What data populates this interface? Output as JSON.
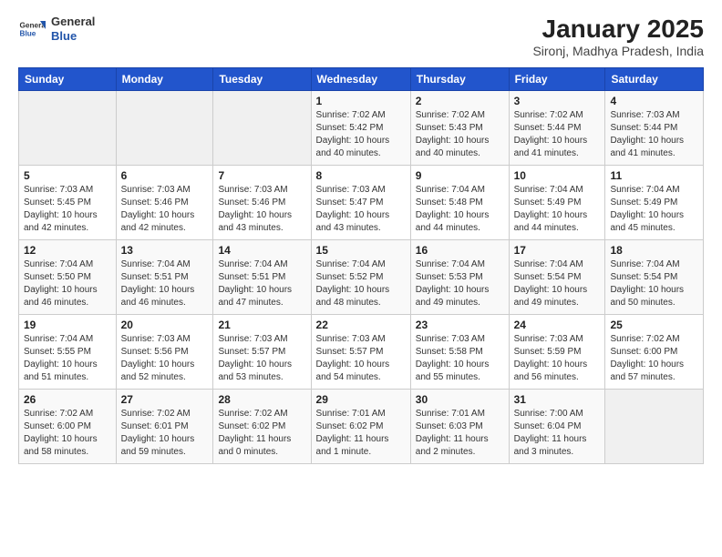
{
  "header": {
    "logo_general": "General",
    "logo_blue": "Blue",
    "month_title": "January 2025",
    "location": "Sironj, Madhya Pradesh, India"
  },
  "weekdays": [
    "Sunday",
    "Monday",
    "Tuesday",
    "Wednesday",
    "Thursday",
    "Friday",
    "Saturday"
  ],
  "weeks": [
    [
      {
        "day": "",
        "info": ""
      },
      {
        "day": "",
        "info": ""
      },
      {
        "day": "",
        "info": ""
      },
      {
        "day": "1",
        "info": "Sunrise: 7:02 AM\nSunset: 5:42 PM\nDaylight: 10 hours\nand 40 minutes."
      },
      {
        "day": "2",
        "info": "Sunrise: 7:02 AM\nSunset: 5:43 PM\nDaylight: 10 hours\nand 40 minutes."
      },
      {
        "day": "3",
        "info": "Sunrise: 7:02 AM\nSunset: 5:44 PM\nDaylight: 10 hours\nand 41 minutes."
      },
      {
        "day": "4",
        "info": "Sunrise: 7:03 AM\nSunset: 5:44 PM\nDaylight: 10 hours\nand 41 minutes."
      }
    ],
    [
      {
        "day": "5",
        "info": "Sunrise: 7:03 AM\nSunset: 5:45 PM\nDaylight: 10 hours\nand 42 minutes."
      },
      {
        "day": "6",
        "info": "Sunrise: 7:03 AM\nSunset: 5:46 PM\nDaylight: 10 hours\nand 42 minutes."
      },
      {
        "day": "7",
        "info": "Sunrise: 7:03 AM\nSunset: 5:46 PM\nDaylight: 10 hours\nand 43 minutes."
      },
      {
        "day": "8",
        "info": "Sunrise: 7:03 AM\nSunset: 5:47 PM\nDaylight: 10 hours\nand 43 minutes."
      },
      {
        "day": "9",
        "info": "Sunrise: 7:04 AM\nSunset: 5:48 PM\nDaylight: 10 hours\nand 44 minutes."
      },
      {
        "day": "10",
        "info": "Sunrise: 7:04 AM\nSunset: 5:49 PM\nDaylight: 10 hours\nand 44 minutes."
      },
      {
        "day": "11",
        "info": "Sunrise: 7:04 AM\nSunset: 5:49 PM\nDaylight: 10 hours\nand 45 minutes."
      }
    ],
    [
      {
        "day": "12",
        "info": "Sunrise: 7:04 AM\nSunset: 5:50 PM\nDaylight: 10 hours\nand 46 minutes."
      },
      {
        "day": "13",
        "info": "Sunrise: 7:04 AM\nSunset: 5:51 PM\nDaylight: 10 hours\nand 46 minutes."
      },
      {
        "day": "14",
        "info": "Sunrise: 7:04 AM\nSunset: 5:51 PM\nDaylight: 10 hours\nand 47 minutes."
      },
      {
        "day": "15",
        "info": "Sunrise: 7:04 AM\nSunset: 5:52 PM\nDaylight: 10 hours\nand 48 minutes."
      },
      {
        "day": "16",
        "info": "Sunrise: 7:04 AM\nSunset: 5:53 PM\nDaylight: 10 hours\nand 49 minutes."
      },
      {
        "day": "17",
        "info": "Sunrise: 7:04 AM\nSunset: 5:54 PM\nDaylight: 10 hours\nand 49 minutes."
      },
      {
        "day": "18",
        "info": "Sunrise: 7:04 AM\nSunset: 5:54 PM\nDaylight: 10 hours\nand 50 minutes."
      }
    ],
    [
      {
        "day": "19",
        "info": "Sunrise: 7:04 AM\nSunset: 5:55 PM\nDaylight: 10 hours\nand 51 minutes."
      },
      {
        "day": "20",
        "info": "Sunrise: 7:03 AM\nSunset: 5:56 PM\nDaylight: 10 hours\nand 52 minutes."
      },
      {
        "day": "21",
        "info": "Sunrise: 7:03 AM\nSunset: 5:57 PM\nDaylight: 10 hours\nand 53 minutes."
      },
      {
        "day": "22",
        "info": "Sunrise: 7:03 AM\nSunset: 5:57 PM\nDaylight: 10 hours\nand 54 minutes."
      },
      {
        "day": "23",
        "info": "Sunrise: 7:03 AM\nSunset: 5:58 PM\nDaylight: 10 hours\nand 55 minutes."
      },
      {
        "day": "24",
        "info": "Sunrise: 7:03 AM\nSunset: 5:59 PM\nDaylight: 10 hours\nand 56 minutes."
      },
      {
        "day": "25",
        "info": "Sunrise: 7:02 AM\nSunset: 6:00 PM\nDaylight: 10 hours\nand 57 minutes."
      }
    ],
    [
      {
        "day": "26",
        "info": "Sunrise: 7:02 AM\nSunset: 6:00 PM\nDaylight: 10 hours\nand 58 minutes."
      },
      {
        "day": "27",
        "info": "Sunrise: 7:02 AM\nSunset: 6:01 PM\nDaylight: 10 hours\nand 59 minutes."
      },
      {
        "day": "28",
        "info": "Sunrise: 7:02 AM\nSunset: 6:02 PM\nDaylight: 11 hours\nand 0 minutes."
      },
      {
        "day": "29",
        "info": "Sunrise: 7:01 AM\nSunset: 6:02 PM\nDaylight: 11 hours\nand 1 minute."
      },
      {
        "day": "30",
        "info": "Sunrise: 7:01 AM\nSunset: 6:03 PM\nDaylight: 11 hours\nand 2 minutes."
      },
      {
        "day": "31",
        "info": "Sunrise: 7:00 AM\nSunset: 6:04 PM\nDaylight: 11 hours\nand 3 minutes."
      },
      {
        "day": "",
        "info": ""
      }
    ]
  ]
}
